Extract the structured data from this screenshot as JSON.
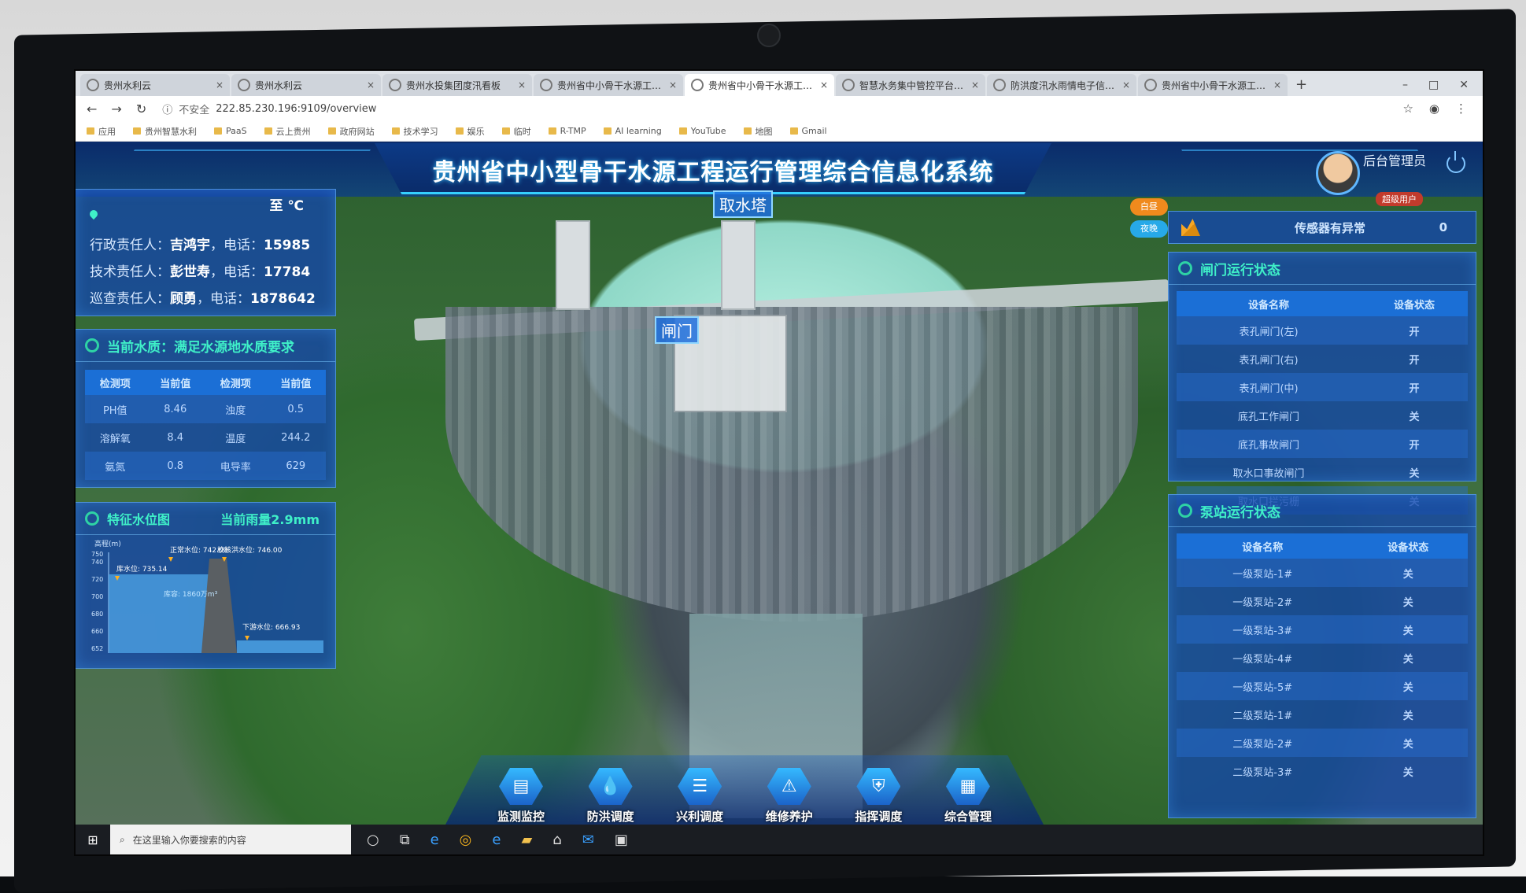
{
  "browser": {
    "tabs": [
      {
        "label": "贵州水利云",
        "active": false
      },
      {
        "label": "贵州水利云",
        "active": false
      },
      {
        "label": "贵州水投集团度汛看板",
        "active": false
      },
      {
        "label": "贵州省中小骨干水源工程管",
        "active": false
      },
      {
        "label": "贵州省中小骨干水源工程管",
        "active": true
      },
      {
        "label": "智慧水务集中管控平台首页",
        "active": false
      },
      {
        "label": "防洪度汛水雨情电子信息化",
        "active": false
      },
      {
        "label": "贵州省中小骨干水源工程管",
        "active": false
      }
    ],
    "new_tab": "+",
    "security_label": "不安全",
    "url": "222.85.230.196:9109/overview",
    "bookmarks": [
      "应用",
      "贵州智慧水利",
      "PaaS",
      "云上贵州",
      "政府网站",
      "技术学习",
      "娱乐",
      "临时",
      "R-TMP",
      "AI learning",
      "YouTube",
      "地图",
      "Gmail"
    ]
  },
  "header": {
    "title": "贵州省中小型骨干水源工程运行管理综合信息化系统",
    "user_name": "后台管理员",
    "user_role": "超级用户"
  },
  "map_labels": {
    "intake_tower": "取水塔",
    "gate": "闸门",
    "pill_day": "白昼",
    "pill_night": "夜晚"
  },
  "weather": {
    "temperature": "至 ℃",
    "contacts": [
      {
        "role": "行政责任人：",
        "name": "吉鸿宇",
        "phone_label": "，电话：",
        "phone": "15985"
      },
      {
        "role": "技术责任人：",
        "name": "彭世寿",
        "phone_label": "，电话：",
        "phone": "17784"
      },
      {
        "role": "巡查责任人：",
        "name": "顾勇",
        "phone_label": "，电话：",
        "phone": "1878642"
      }
    ]
  },
  "water_quality": {
    "title": "当前水质：满足水源地水质要求",
    "headers": [
      "检测项",
      "当前值",
      "检测项",
      "当前值"
    ],
    "rows": [
      [
        "PH值",
        "8.46",
        "浊度",
        "0.5"
      ],
      [
        "溶解氧",
        "8.4",
        "温度",
        "244.2"
      ],
      [
        "氨氮",
        "0.8",
        "电导率",
        "629"
      ]
    ]
  },
  "water_level": {
    "title": "特征水位图",
    "rain": "当前雨量2.9mm",
    "y_axis_label": "高程(m)",
    "y_ticks": [
      "750",
      "740",
      "720",
      "700",
      "680",
      "660",
      "652"
    ],
    "annotations": {
      "normal": "正常水位: 742.00",
      "check": "校核洪水位: 746.00",
      "current": "库水位: 735.14",
      "capacity": "库容: 1860万m³",
      "downstream": "下游水位: 666.93"
    }
  },
  "sensor_alert": {
    "label": "传感器有异常",
    "count": "0"
  },
  "gates": {
    "title": "闸门运行状态",
    "headers": [
      "设备名称",
      "设备状态"
    ],
    "rows": [
      {
        "name": "表孔闸门(左)",
        "status": "开",
        "open": true
      },
      {
        "name": "表孔闸门(右)",
        "status": "开",
        "open": true
      },
      {
        "name": "表孔闸门(中)",
        "status": "开",
        "open": true
      },
      {
        "name": "底孔工作闸门",
        "status": "关",
        "open": false
      },
      {
        "name": "底孔事故闸门",
        "status": "开",
        "open": true
      },
      {
        "name": "取水口事故闸门",
        "status": "关",
        "open": false
      },
      {
        "name": "取水口拦污栅",
        "status": "关",
        "open": false
      }
    ]
  },
  "pumps": {
    "title": "泵站运行状态",
    "headers": [
      "设备名称",
      "设备状态"
    ],
    "rows": [
      {
        "name": "一级泵站-1#",
        "status": "关"
      },
      {
        "name": "一级泵站-2#",
        "status": "关"
      },
      {
        "name": "一级泵站-3#",
        "status": "关"
      },
      {
        "name": "一级泵站-4#",
        "status": "关"
      },
      {
        "name": "一级泵站-5#",
        "status": "关"
      },
      {
        "name": "二级泵站-1#",
        "status": "关"
      },
      {
        "name": "二级泵站-2#",
        "status": "关"
      },
      {
        "name": "二级泵站-3#",
        "status": "关"
      }
    ]
  },
  "bottom_nav": [
    {
      "label": "监测监控",
      "icon": "monitor-icon",
      "glyph": "▤"
    },
    {
      "label": "防洪调度",
      "icon": "water-drop-icon",
      "glyph": "💧"
    },
    {
      "label": "兴利调度",
      "icon": "sliders-icon",
      "glyph": "☰"
    },
    {
      "label": "维修养护",
      "icon": "maintenance-icon",
      "glyph": "⚠"
    },
    {
      "label": "指挥调度",
      "icon": "shield-icon",
      "glyph": "⛨"
    },
    {
      "label": "综合管理",
      "icon": "document-icon",
      "glyph": "▦"
    }
  ],
  "taskbar": {
    "search_placeholder": "在这里输入你要搜索的内容"
  },
  "colors": {
    "accent": "#3ff0c8",
    "open": "#2ee66b",
    "closed": "#ff3b3b",
    "panel": "#1b6fd6"
  }
}
